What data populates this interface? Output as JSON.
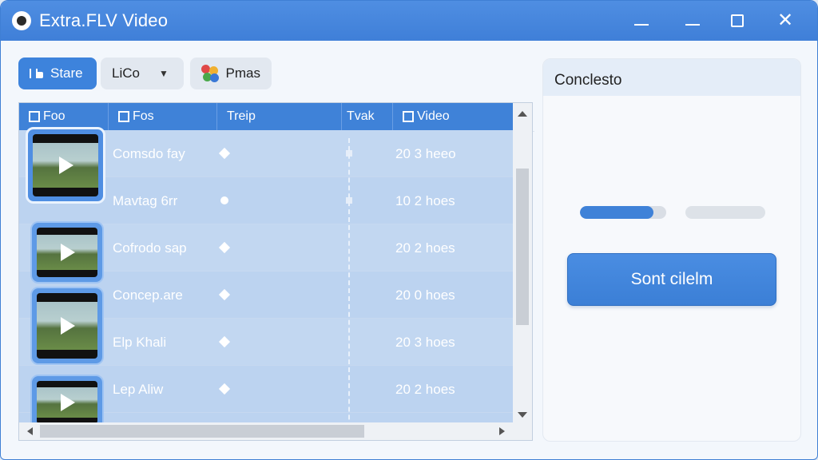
{
  "window": {
    "title": "Extra.FLV Video",
    "controls": {
      "minimize": "—",
      "maximize": "☐",
      "close": "✕"
    }
  },
  "toolbar": {
    "start_label": "Stare",
    "lico_label": "LiCo",
    "pmas_label": "Pmas"
  },
  "table": {
    "columns": [
      "Foo",
      "Fos",
      "Treip",
      "Tvak",
      "Video"
    ],
    "rows": [
      {
        "name": "Comsdo fay",
        "duration": "20 3 heeo",
        "selected": true
      },
      {
        "name": "Mavtag 6rr",
        "duration": "10 2 hoes",
        "selected": false
      },
      {
        "name": "Cofrodo sap",
        "duration": "20 2 hoes",
        "selected": false
      },
      {
        "name": "Concep.are",
        "duration": "20 0 hoes",
        "selected": false
      },
      {
        "name": "Elp Khali",
        "duration": "20 3 hoes",
        "selected": false
      },
      {
        "name": "Lep Aliw",
        "duration": "20 2 hoes",
        "selected": false
      }
    ]
  },
  "panel": {
    "title": "Conclesto",
    "progress_primary": 0.85,
    "progress_secondary": 0.0,
    "sort_button_label": "Sont cilelm"
  },
  "colors": {
    "accent": "#3f82d8",
    "titlebar": "#4587dd",
    "row_bg": "#bcd3f0"
  }
}
